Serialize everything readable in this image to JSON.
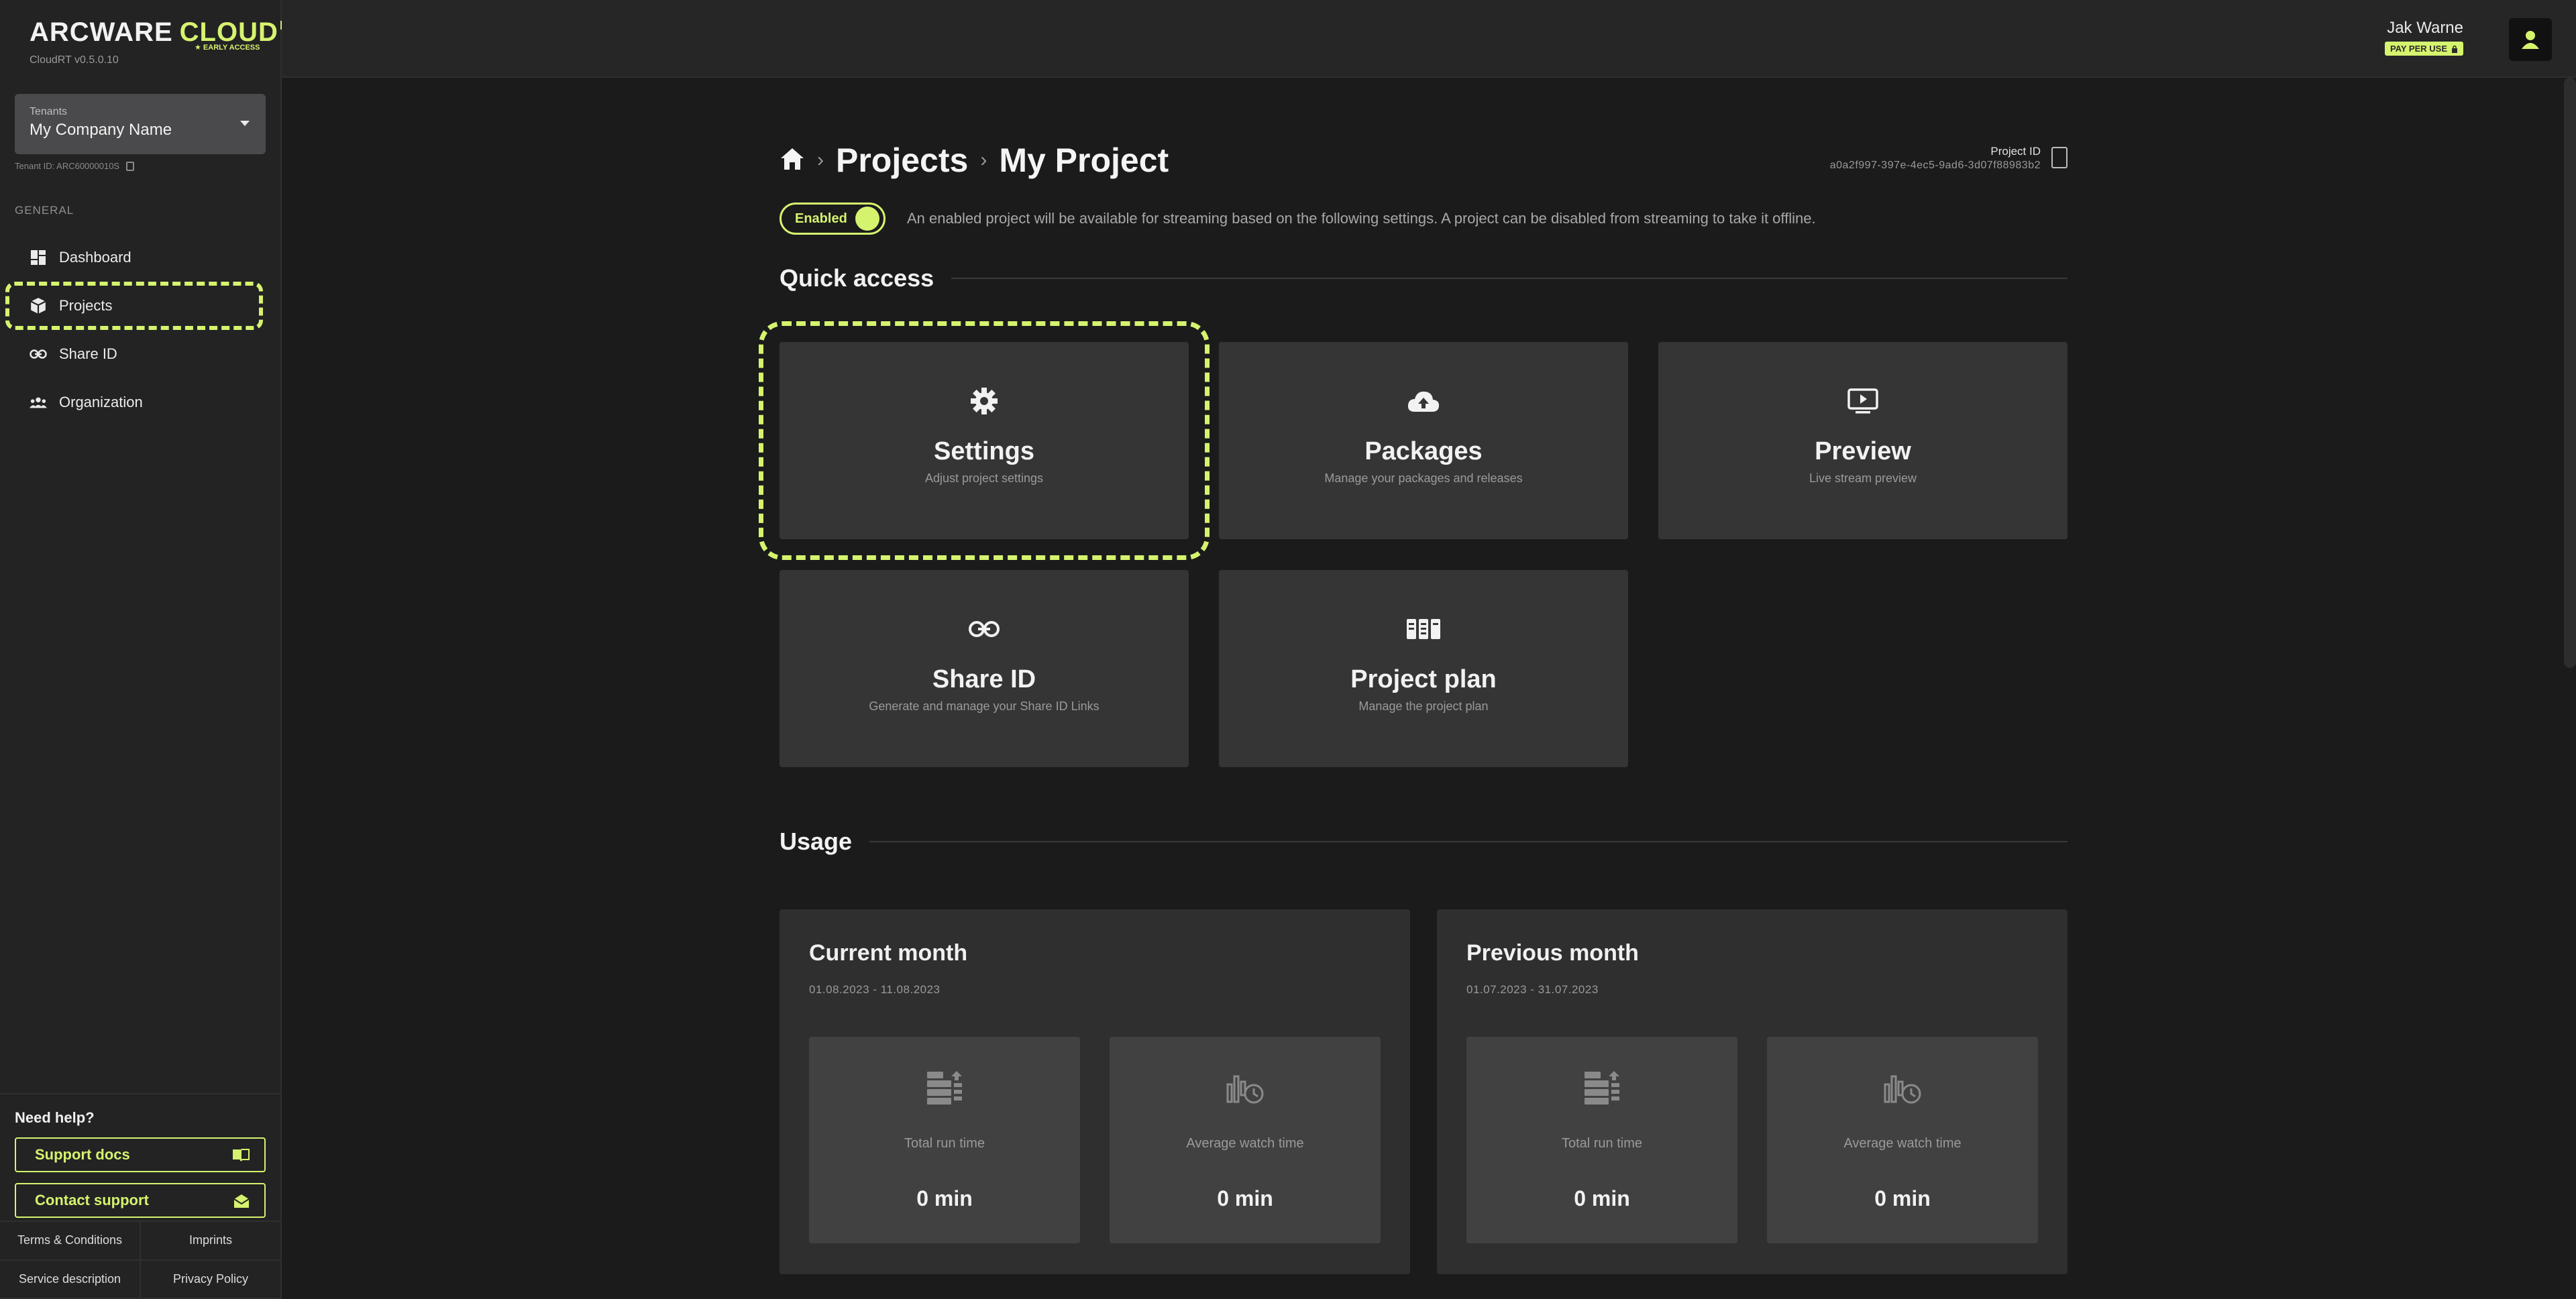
{
  "sidebar": {
    "logo_text": "ARCWARE",
    "logo_cloud": "CLOUD",
    "logo_rt": "RT",
    "logo_badge": "★ EARLY ACCESS",
    "version": "CloudRT v0.5.0.10",
    "tenant_label": "Tenants",
    "tenant_name": "My Company Name",
    "tenant_id": "Tenant ID: ARC60000010S",
    "nav_section": "GENERAL",
    "nav": [
      {
        "label": "Dashboard",
        "icon": "dashboard-icon"
      },
      {
        "label": "Projects",
        "icon": "cube-icon"
      },
      {
        "label": "Share ID",
        "icon": "link-icon"
      },
      {
        "label": "Organization",
        "icon": "people-icon"
      }
    ],
    "help_title": "Need help?",
    "support_docs": "Support docs",
    "contact_support": "Contact support",
    "footer": [
      "Terms & Conditions",
      "Imprints",
      "Service description",
      "Privacy Policy"
    ]
  },
  "topbar": {
    "user_name": "Jak Warne",
    "user_badge": "PAY PER USE"
  },
  "breadcrumb": {
    "level1": "Projects",
    "level2": "My Project"
  },
  "project": {
    "id_label": "Project ID",
    "id_value": "a0a2f997-397e-4ec5-9ad6-3d07f88983b2",
    "toggle_label": "Enabled",
    "enabled_desc": "An enabled project will be available for streaming based on the following settings. A project can be disabled from streaming to take it offline."
  },
  "quick_access": {
    "title": "Quick access",
    "cards": [
      {
        "title": "Settings",
        "sub": "Adjust project settings",
        "icon": "gear-icon"
      },
      {
        "title": "Packages",
        "sub": "Manage your packages and releases",
        "icon": "cloud-upload-icon"
      },
      {
        "title": "Preview",
        "sub": "Live stream preview",
        "icon": "play-screen-icon"
      },
      {
        "title": "Share ID",
        "sub": "Generate and manage your Share ID Links",
        "icon": "link-icon"
      },
      {
        "title": "Project plan",
        "sub": "Manage the project plan",
        "icon": "plan-icon"
      }
    ]
  },
  "usage": {
    "title": "Usage",
    "panels": [
      {
        "title": "Current month",
        "range": "01.08.2023 - 11.08.2023",
        "stats": [
          {
            "label": "Total run time",
            "value": "0 min"
          },
          {
            "label": "Average watch time",
            "value": "0 min"
          }
        ]
      },
      {
        "title": "Previous month",
        "range": "01.07.2023 - 31.07.2023",
        "stats": [
          {
            "label": "Total run time",
            "value": "0 min"
          },
          {
            "label": "Average watch time",
            "value": "0 min"
          }
        ]
      }
    ]
  },
  "colors": {
    "accent": "#d6f36e",
    "background": "#1b1b1c",
    "sidebar": "#232324",
    "card": "#353536"
  }
}
